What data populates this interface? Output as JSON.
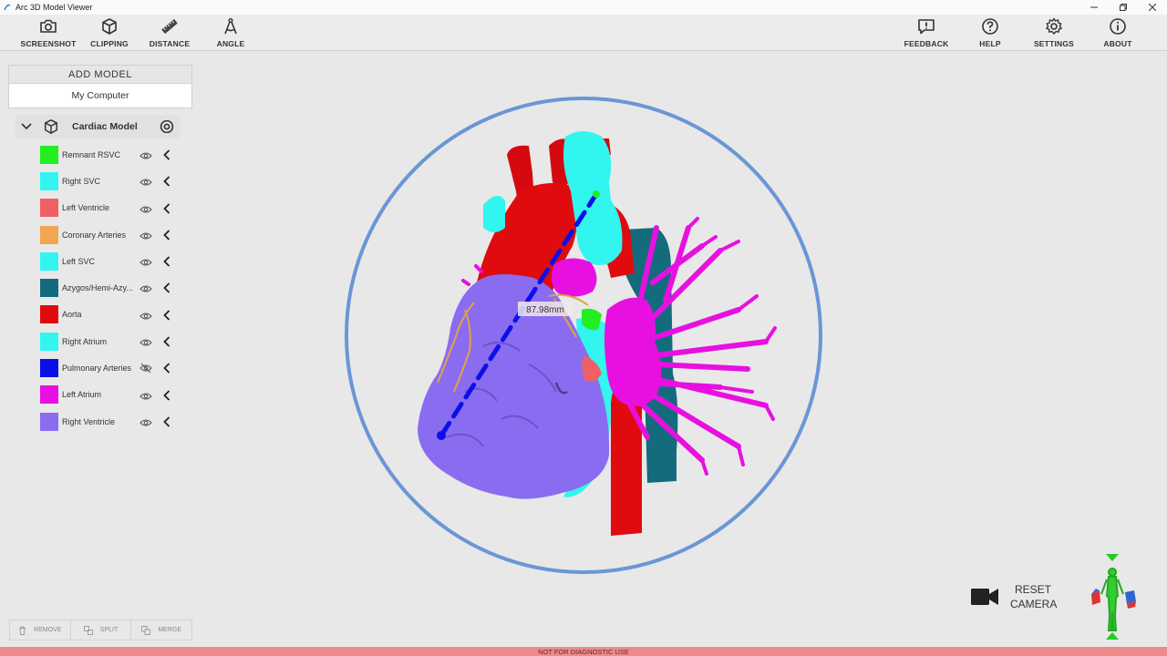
{
  "window": {
    "title": "Arc 3D Model Viewer"
  },
  "toolbar": {
    "screenshot": "SCREENSHOT",
    "clipping": "CLIPPING",
    "distance": "DISTANCE",
    "angle": "ANGLE",
    "feedback": "FEEDBACK",
    "help": "HELP",
    "settings": "SETTINGS",
    "about": "ABOUT"
  },
  "add_model": {
    "title": "ADD MODEL",
    "source": "My Computer"
  },
  "model": {
    "name": "Cardiac Model",
    "layers": [
      {
        "label": "Remnant RSVC",
        "color": "#22ee22",
        "visible": true
      },
      {
        "label": "Right SVC",
        "color": "#33f5ef",
        "visible": true
      },
      {
        "label": "Left Ventricle",
        "color": "#ee6066",
        "visible": true
      },
      {
        "label": "Coronary Arteries",
        "color": "#f2a652",
        "visible": true
      },
      {
        "label": "Left SVC",
        "color": "#33f5ef",
        "visible": true
      },
      {
        "label": "Azygos/Hemi-Azy...",
        "color": "#146b7e",
        "visible": true
      },
      {
        "label": "Aorta",
        "color": "#e00b0f",
        "visible": true
      },
      {
        "label": "Right Atrium",
        "color": "#33f5ef",
        "visible": true
      },
      {
        "label": "Pulmonary Arteries",
        "color": "#0b10e8",
        "visible": false
      },
      {
        "label": "Left Atrium",
        "color": "#e810e0",
        "visible": true
      },
      {
        "label": "Right Ventricle",
        "color": "#8a6cf0",
        "visible": true
      }
    ]
  },
  "measurement": {
    "label": "87.98mm"
  },
  "bottom_buttons": {
    "remove": "REMOVE",
    "split": "SPLIT",
    "merge": "MERGE"
  },
  "camera": {
    "line1": "RESET",
    "line2": "CAMERA"
  },
  "status": {
    "disclaimer": "NOT FOR DIAGNOSTIC USE"
  },
  "colors": {
    "rotation_ring": "#6a96d6",
    "status_bar": "#f08a8a"
  }
}
